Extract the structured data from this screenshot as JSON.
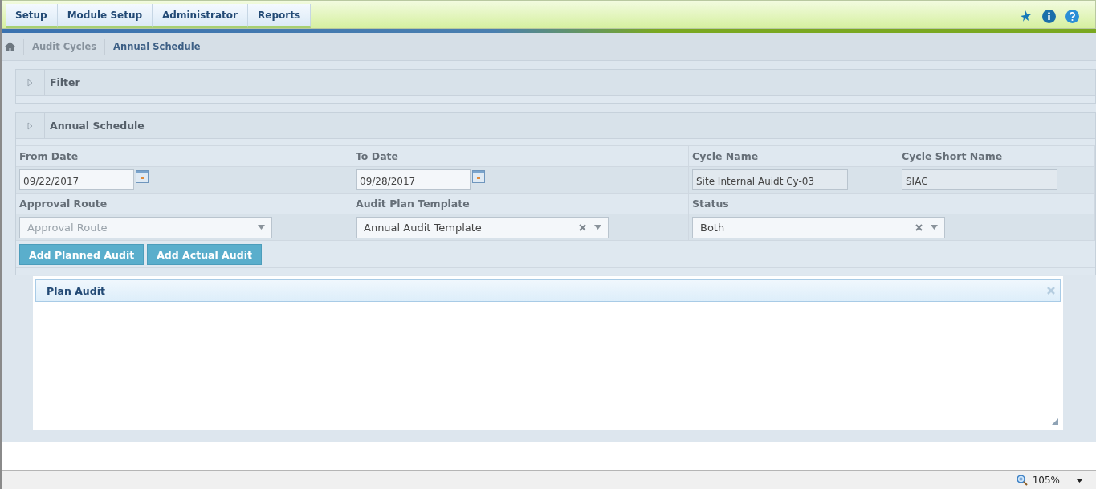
{
  "nav": {
    "tabs": [
      "Setup",
      "Module Setup",
      "Administrator",
      "Reports"
    ]
  },
  "breadcrumb": [
    "Audit Cycles",
    "Annual Schedule"
  ],
  "filter_panel": {
    "title": "Filter",
    "expanded": false
  },
  "schedule_panel": {
    "title": "Annual Schedule",
    "expanded": false,
    "rows": [
      [
        {
          "label": "From Date",
          "kind": "date",
          "value": "09/22/2017"
        },
        {
          "label": "To Date",
          "kind": "date",
          "value": "09/28/2017"
        },
        {
          "label": "Cycle Name",
          "kind": "text",
          "value": "Site Internal Auidt Cy-03"
        },
        {
          "label": "Cycle Short Name",
          "kind": "text",
          "value": "SIAC"
        }
      ],
      [
        {
          "label": "Approval Route",
          "kind": "select",
          "placeholder": "Approval Route"
        },
        {
          "label": "Audit Plan Template",
          "kind": "select",
          "value": "Annual Audit Template"
        },
        {
          "label": "Status",
          "kind": "select",
          "value": "Both"
        }
      ]
    ],
    "buttons": [
      "Add Planned Audit",
      "Add Actual Audit"
    ]
  },
  "dialog": {
    "title": "Plan Audit"
  },
  "status_bar": {
    "zoom": "105%"
  }
}
